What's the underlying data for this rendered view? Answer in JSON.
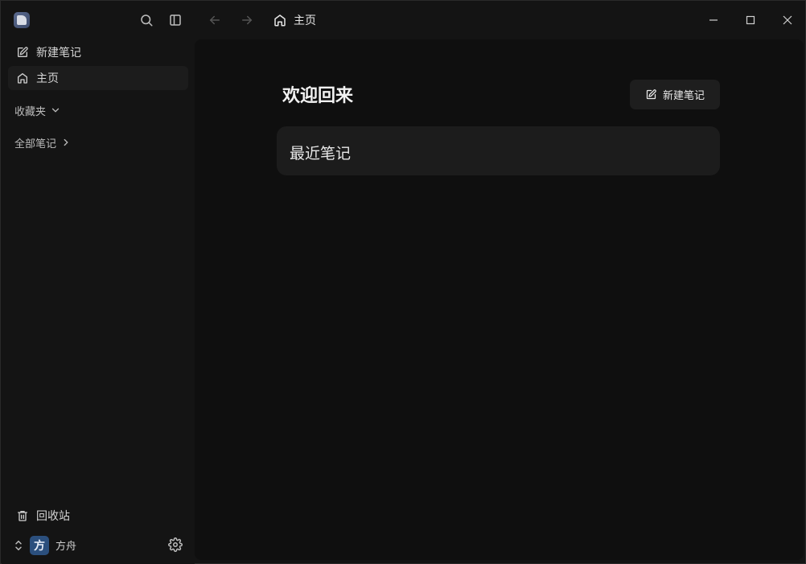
{
  "topbar": {
    "page_title": "主页"
  },
  "sidebar": {
    "new_note_label": "新建笔记",
    "home_label": "主页",
    "favorites_label": "收藏夹",
    "all_notes_label": "全部笔记",
    "trash_label": "回收站",
    "user": {
      "avatar_char": "方",
      "name": "方舟"
    }
  },
  "main": {
    "welcome_title": "欢迎回来",
    "new_note_button_label": "新建笔记",
    "recent_notes_title": "最近笔记"
  },
  "colors": {
    "background": "#141414",
    "main_panel": "#0f0f0f",
    "card": "#1c1c1c",
    "avatar": "#2b4f7d"
  }
}
